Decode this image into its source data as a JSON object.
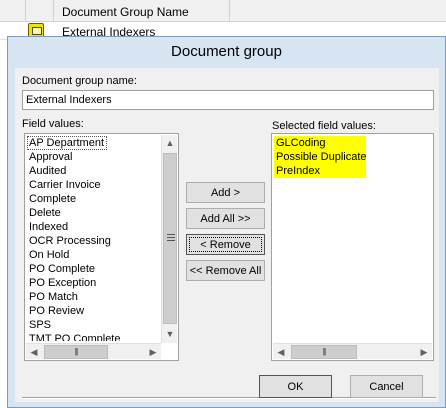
{
  "background": {
    "column_header": "Document Group Name",
    "row_value": "External Indexers"
  },
  "dialog": {
    "title": "Document group",
    "name_label": "Document group name:",
    "name_value": "External Indexers",
    "field_values_label": "Field values:",
    "selected_label": "Selected field values:",
    "field_values": [
      "AP Department",
      "Approval",
      "Audited",
      "Carrier Invoice",
      "Complete",
      "Delete",
      "Indexed",
      "OCR Processing",
      "On Hold",
      "PO Complete",
      "PO Exception",
      "PO Match",
      "PO Review",
      "SPS",
      "TMT PO Complete"
    ],
    "selected_values": [
      "GLCoding",
      "Possible Duplicate",
      "PreIndex"
    ],
    "buttons": {
      "add": "Add >",
      "add_all": "Add All >>",
      "remove": "< Remove",
      "remove_all": "<< Remove All",
      "ok": "OK",
      "cancel": "Cancel"
    },
    "colors": {
      "highlight": "#ffff00",
      "titlebar": "#d7e4f2"
    }
  }
}
